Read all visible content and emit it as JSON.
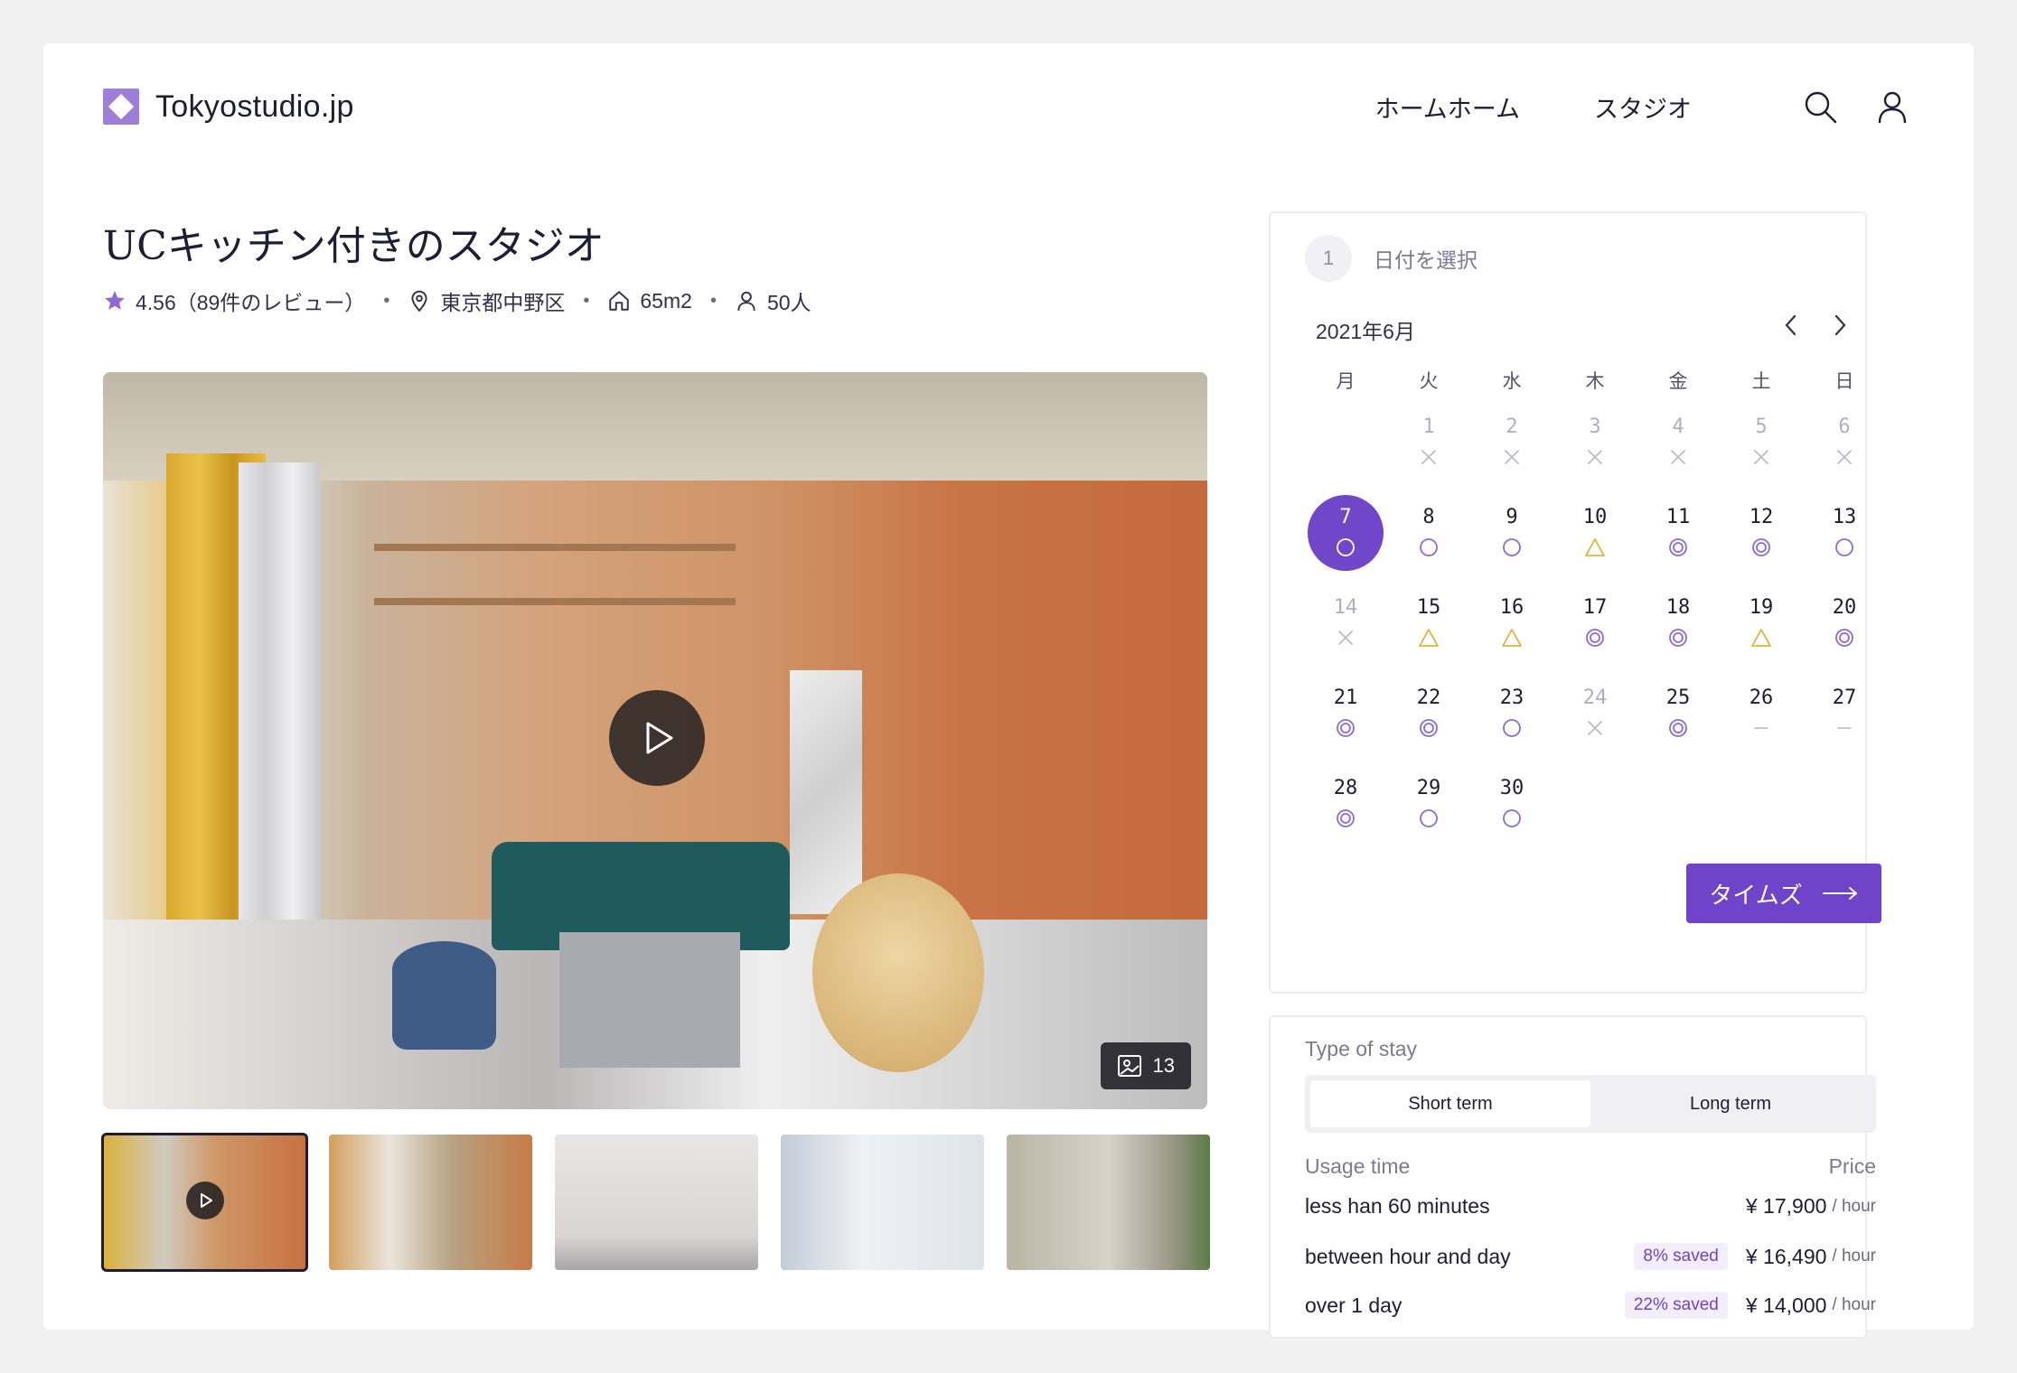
{
  "brand": {
    "name": "Tokyostudio.jp",
    "accent": "#7047c8",
    "logo_color": "#9d7fd8"
  },
  "nav": {
    "items": [
      {
        "label": "ホームホーム"
      },
      {
        "label": "スタジオ"
      }
    ],
    "search_icon": "search-icon",
    "user_icon": "user-icon"
  },
  "listing": {
    "title": "UCキッチン付きのスタジオ",
    "rating": "4.56（89件のレビュー）",
    "location": "東京都中野区",
    "area": "65m2",
    "capacity": "50人"
  },
  "gallery": {
    "photo_count": "13",
    "thumbnails": 5,
    "active_thumbnail": 1
  },
  "booking": {
    "step_number": "1",
    "step_label": "日付を選択",
    "month": "2021年6月",
    "weekdays": [
      "月",
      "火",
      "水",
      "木",
      "金",
      "土",
      "日"
    ],
    "weeks": [
      [
        null,
        {
          "d": "1",
          "s": "x",
          "off": true
        },
        {
          "d": "2",
          "s": "x",
          "off": true
        },
        {
          "d": "3",
          "s": "x",
          "off": true
        },
        {
          "d": "4",
          "s": "x",
          "off": true
        },
        {
          "d": "5",
          "s": "x",
          "off": true
        },
        {
          "d": "6",
          "s": "x",
          "off": true
        }
      ],
      [
        {
          "d": "7",
          "s": "circle",
          "selected": true
        },
        {
          "d": "8",
          "s": "circle"
        },
        {
          "d": "9",
          "s": "circle"
        },
        {
          "d": "10",
          "s": "triangle"
        },
        {
          "d": "11",
          "s": "double"
        },
        {
          "d": "12",
          "s": "double"
        },
        {
          "d": "13",
          "s": "circle"
        }
      ],
      [
        {
          "d": "14",
          "s": "x",
          "off": true
        },
        {
          "d": "15",
          "s": "triangle"
        },
        {
          "d": "16",
          "s": "triangle"
        },
        {
          "d": "17",
          "s": "double"
        },
        {
          "d": "18",
          "s": "double"
        },
        {
          "d": "19",
          "s": "triangle"
        },
        {
          "d": "20",
          "s": "double"
        }
      ],
      [
        {
          "d": "21",
          "s": "double"
        },
        {
          "d": "22",
          "s": "double"
        },
        {
          "d": "23",
          "s": "circle"
        },
        {
          "d": "24",
          "s": "x",
          "off": true
        },
        {
          "d": "25",
          "s": "double"
        },
        {
          "d": "26",
          "s": "dash"
        },
        {
          "d": "27",
          "s": "dash"
        }
      ],
      [
        {
          "d": "28",
          "s": "double"
        },
        {
          "d": "29",
          "s": "circle"
        },
        {
          "d": "30",
          "s": "circle"
        },
        null,
        null,
        null,
        null
      ]
    ],
    "cta_label": "タイムズ",
    "colors": {
      "available": "#8d6ad6",
      "limited": "#e2b33a",
      "unavailable": "#b9b6c6"
    }
  },
  "pricing": {
    "stay_label": "Type of stay",
    "options": [
      "Short term",
      "Long term"
    ],
    "active_option": 0,
    "usage_header": "Usage time",
    "price_header": "Price",
    "rows": [
      {
        "usage": "less han 60 minutes",
        "saved": "",
        "amount": "¥ 17,900",
        "unit": "/ hour"
      },
      {
        "usage": "between hour and day",
        "saved": "8% saved",
        "amount": "¥ 16,490",
        "unit": "/ hour"
      },
      {
        "usage": "over 1 day",
        "saved": "22% saved",
        "amount": "¥ 14,000",
        "unit": "/ hour"
      }
    ]
  }
}
